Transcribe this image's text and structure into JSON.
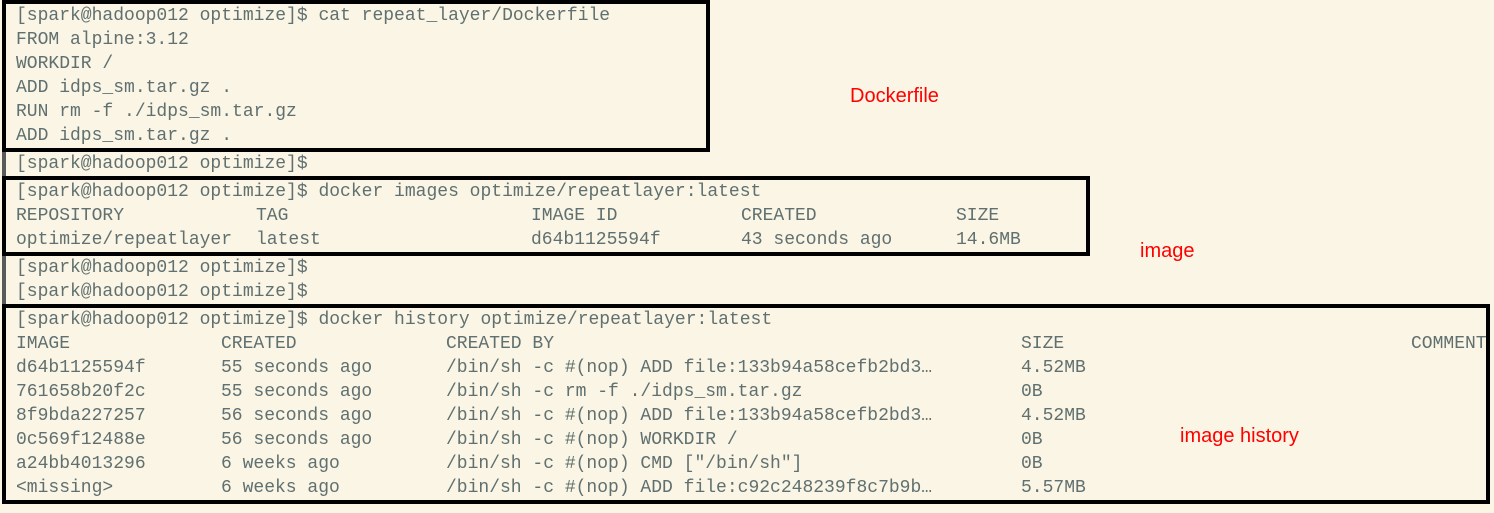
{
  "labels": {
    "dockerfile": "Dockerfile",
    "image": "image",
    "history": "image history"
  },
  "dockerfile": {
    "prompt1": "[spark@hadoop012 optimize]$ cat repeat_layer/Dockerfile",
    "line1": "FROM alpine:3.12",
    "line2": "",
    "line3": "WORKDIR /",
    "line4": "ADD idps_sm.tar.gz .",
    "line5": "RUN rm  -f ./idps_sm.tar.gz",
    "line6": "ADD idps_sm.tar.gz .",
    "prompt_after": "[spark@hadoop012 optimize]$"
  },
  "image": {
    "cmd": "[spark@hadoop012 optimize]$ docker images optimize/repeatlayer:latest",
    "hdr_repo": "REPOSITORY",
    "hdr_tag": "TAG",
    "hdr_id": "IMAGE ID",
    "hdr_created": "CREATED",
    "hdr_size": "SIZE",
    "row_repo": "optimize/repeatlayer",
    "row_tag": "latest",
    "row_id": "d64b1125594f",
    "row_created": "43 seconds ago",
    "row_size": "14.6MB",
    "prompt_after1": "[spark@hadoop012 optimize]$",
    "prompt_after2": "[spark@hadoop012 optimize]$"
  },
  "history": {
    "cmd": "[spark@hadoop012 optimize]$ docker history optimize/repeatlayer:latest",
    "h_image": "IMAGE",
    "h_created": "CREATED",
    "h_createdby": "CREATED BY",
    "h_size": "SIZE",
    "h_comment": "COMMENT",
    "r1_image": "d64b1125594f",
    "r1_created": "55 seconds ago",
    "r1_by": "/bin/sh -c #(nop) ADD file:133b94a58cefb2bd3…",
    "r1_size": "4.52MB",
    "r2_image": "761658b20f2c",
    "r2_created": "55 seconds ago",
    "r2_by": "/bin/sh -c rm  -f ./idps_sm.tar.gz",
    "r2_size": "0B",
    "r3_image": "8f9bda227257",
    "r3_created": "56 seconds ago",
    "r3_by": "/bin/sh -c #(nop) ADD file:133b94a58cefb2bd3…",
    "r3_size": "4.52MB",
    "r4_image": "0c569f12488e",
    "r4_created": "56 seconds ago",
    "r4_by": "/bin/sh -c #(nop) WORKDIR /",
    "r4_size": "0B",
    "r5_image": "a24bb4013296",
    "r5_created": "6 weeks ago",
    "r5_by": "/bin/sh -c #(nop)  CMD [\"/bin/sh\"]",
    "r5_size": "0B",
    "r6_image": "<missing>",
    "r6_created": "6 weeks ago",
    "r6_by": "/bin/sh -c #(nop) ADD file:c92c248239f8c7b9b…",
    "r6_size": "5.57MB"
  }
}
